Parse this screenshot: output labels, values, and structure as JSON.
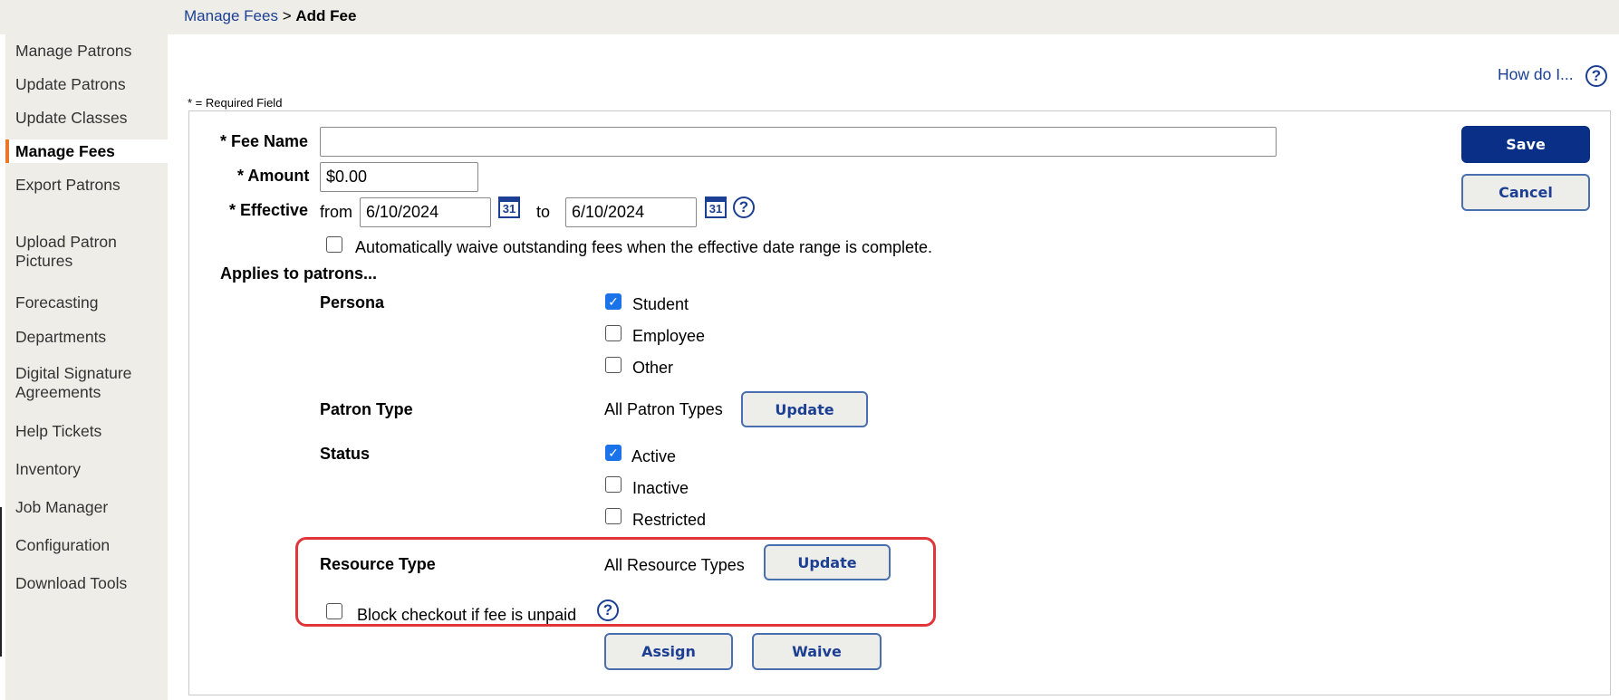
{
  "breadcrumb": {
    "parent": "Manage Fees",
    "separator": ">",
    "current": "Add Fee"
  },
  "sidebar": {
    "items": [
      {
        "label": "Manage Patrons"
      },
      {
        "label": "Update Patrons"
      },
      {
        "label": "Update Classes"
      },
      {
        "label": "Manage Fees",
        "active": true
      },
      {
        "label": "Export Patrons"
      },
      {
        "label": "Upload Patron Pictures"
      },
      {
        "label": "Forecasting"
      },
      {
        "label": "Departments"
      },
      {
        "label": "Digital Signature Agreements"
      },
      {
        "label": "Help Tickets"
      },
      {
        "label": "Inventory"
      },
      {
        "label": "Job Manager"
      },
      {
        "label": "Configuration"
      },
      {
        "label": "Download Tools"
      }
    ]
  },
  "help": {
    "link_label": "How do I...",
    "icon": "question-circle-icon"
  },
  "form": {
    "required_note": "* = Required Field",
    "fee_name": {
      "label": "* Fee Name",
      "value": ""
    },
    "amount": {
      "label": "* Amount",
      "value": "$0.00"
    },
    "effective": {
      "label": "* Effective",
      "from_label": "from",
      "from_value": "6/10/2024",
      "to_label": "to",
      "to_value": "6/10/2024",
      "calendar_icon_text": "31"
    },
    "auto_waive": {
      "label": "Automatically waive outstanding fees when the effective date range is complete.",
      "checked": false
    },
    "applies_heading": "Applies to patrons...",
    "persona": {
      "label": "Persona",
      "options": [
        {
          "label": "Student",
          "checked": true
        },
        {
          "label": "Employee",
          "checked": false
        },
        {
          "label": "Other",
          "checked": false
        }
      ]
    },
    "patron_type": {
      "label": "Patron Type",
      "value": "All Patron Types",
      "button": "Update"
    },
    "status": {
      "label": "Status",
      "options": [
        {
          "label": "Active",
          "checked": true
        },
        {
          "label": "Inactive",
          "checked": false
        },
        {
          "label": "Restricted",
          "checked": false
        }
      ]
    },
    "resource_type": {
      "label": "Resource Type",
      "value": "All Resource Types",
      "button": "Update"
    },
    "block_checkout": {
      "label": "Block checkout if fee is unpaid",
      "checked": false
    }
  },
  "actions": {
    "save": "Save",
    "cancel": "Cancel",
    "assign": "Assign",
    "waive": "Waive"
  },
  "colors": {
    "accent": "#0a2f86",
    "link": "#1c3f94",
    "highlight": "#e0353b",
    "active_marker": "#e8792b"
  }
}
